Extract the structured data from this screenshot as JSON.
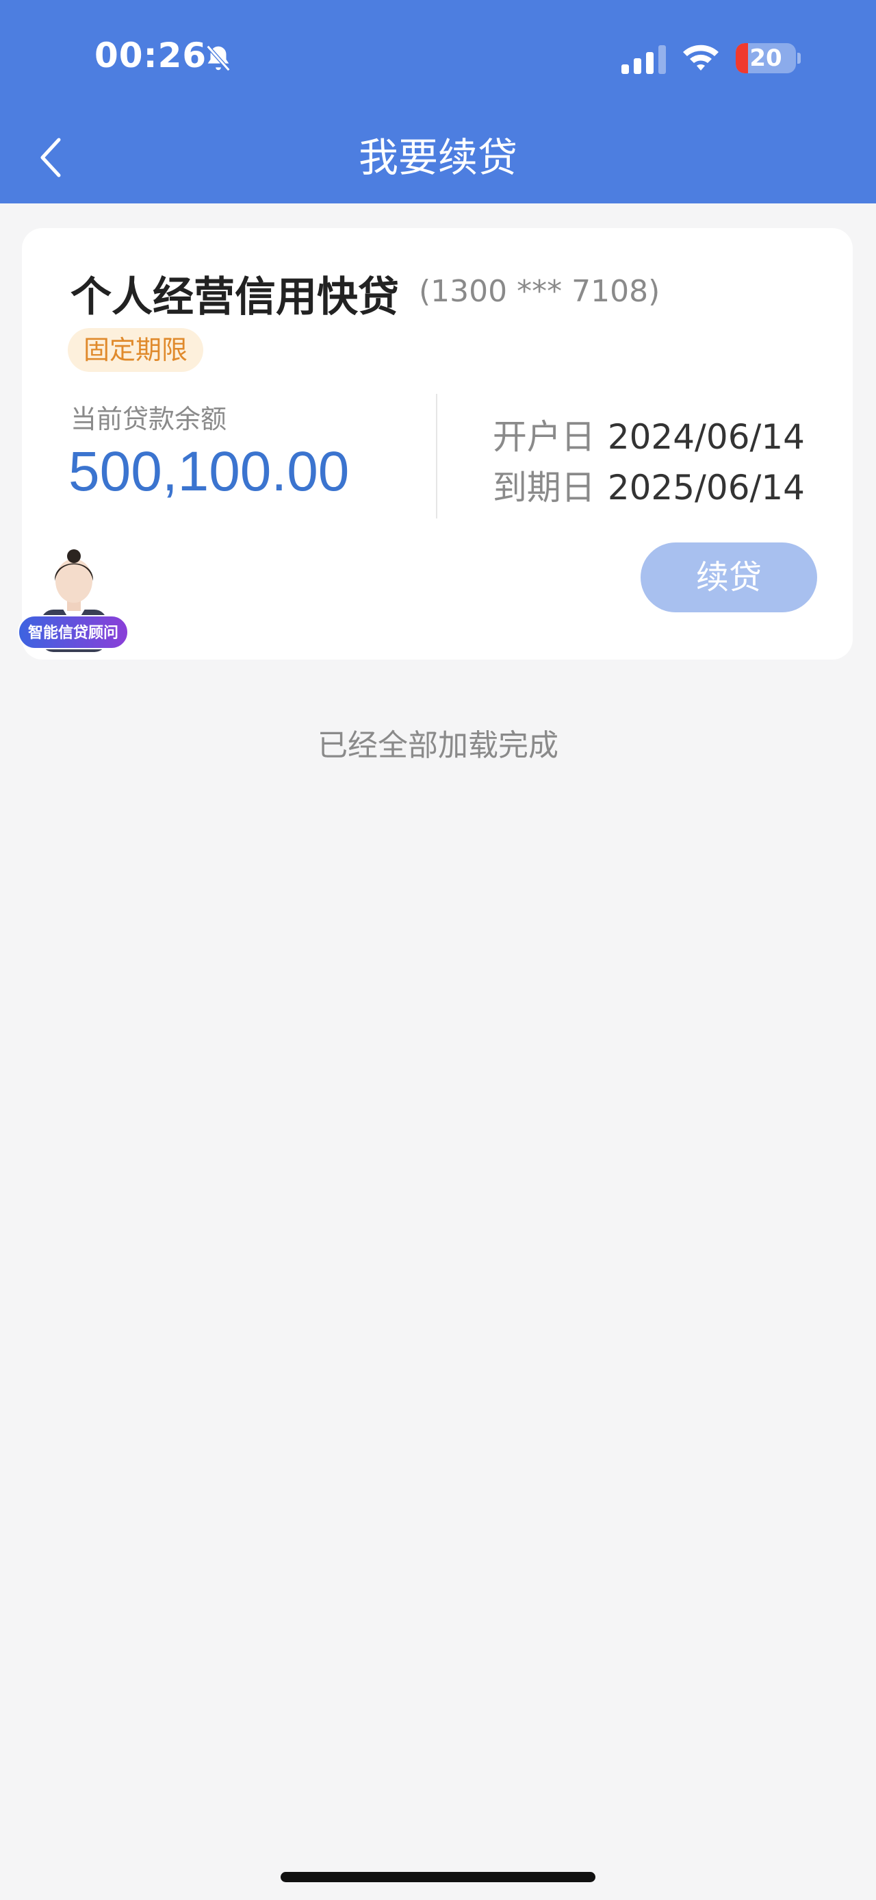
{
  "status_bar": {
    "time": "00:26",
    "battery": "20",
    "icons": [
      "bell-muted-icon",
      "signal-icon",
      "wifi-icon",
      "battery-icon"
    ]
  },
  "nav": {
    "title": "我要续贷",
    "back_icon": "chevron-left-icon"
  },
  "loan_card": {
    "product_name": "个人经营信用快贷",
    "account_no": "(1300 *** 7108)",
    "tag": "固定期限",
    "balance_label": "当前贷款余额",
    "balance": "500,100.00",
    "open_date_label": "开户日",
    "open_date": "2024/06/14",
    "due_date_label": "到期日",
    "due_date": "2025/06/14",
    "renew_button": "续贷"
  },
  "advisor": {
    "badge": "智能信贷顾问"
  },
  "footer": {
    "loaded_text": "已经全部加载完成"
  },
  "colors": {
    "header_bg": "#4d7ee0",
    "balance": "#3b74cf",
    "tag_text": "#e08a2c",
    "tag_bg": "#fdf0dc",
    "button_disabled": "#a8c0ef"
  }
}
